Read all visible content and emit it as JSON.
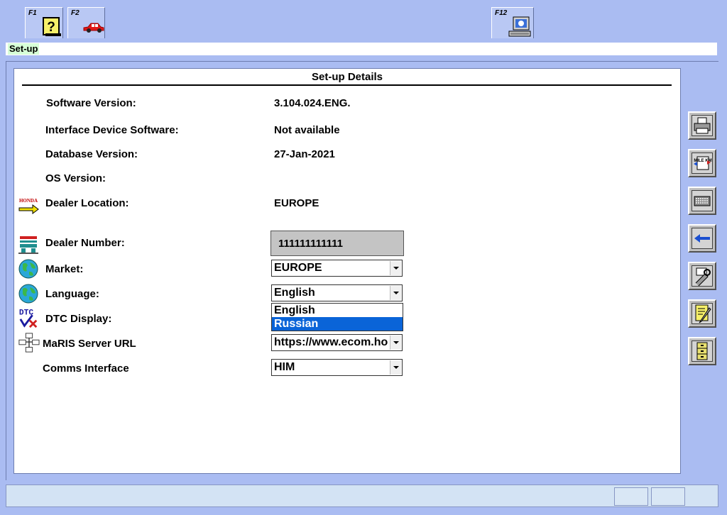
{
  "function_keys": [
    {
      "key": "F1",
      "icon": "help-icon"
    },
    {
      "key": "F2",
      "icon": "car-icon"
    },
    {
      "key": "F12",
      "icon": "computer-icon"
    }
  ],
  "breadcrumb": "Set-up",
  "panel_title": "Set-up Details",
  "fields": {
    "software_version": {
      "label": "Software Version:",
      "value": "3.104.024.ENG."
    },
    "interface_device": {
      "label": "Interface Device Software:",
      "value": "Not available"
    },
    "database_version": {
      "label": "Database Version:",
      "value": "27-Jan-2021"
    },
    "os_version": {
      "label": "OS Version:",
      "value": ""
    },
    "dealer_location": {
      "label": "Dealer Location:",
      "value": "EUROPE"
    },
    "dealer_number": {
      "label": "Dealer Number:",
      "value": "111111111111"
    },
    "market": {
      "label": "Market:",
      "value": "EUROPE"
    },
    "language": {
      "label": "Language:",
      "value": "English",
      "options": [
        "English",
        "Russian"
      ],
      "highlighted": "Russian"
    },
    "dtc_display": {
      "label": "DTC Display:"
    },
    "maris_url": {
      "label": "MaRIS Server URL",
      "value": "https://www.ecom.ho"
    },
    "comms_interface": {
      "label": "Comms Interface",
      "value": "HIM"
    }
  },
  "row_icons": {
    "dealer_location": "honda-flag-icon",
    "dealer_number": "dealer-number-icon",
    "market": "globe-icon",
    "language": "globe-icon",
    "dtc_display": "dtc-icon",
    "maris_url": "network-icon"
  },
  "honda_logo_text": "HONDA",
  "dtc_icon_text": "DTC",
  "side_buttons": [
    "print-icon",
    "mile-km-icon",
    "keyboard-icon",
    "back-arrow-icon",
    "tools-icon",
    "notes-icon",
    "cabinet-icon"
  ],
  "mile_km_text": "MILE KM",
  "colors": {
    "background": "#aabcf2",
    "highlight": "#0a64d8",
    "breadcrumb_bg": "#d7ffd7"
  }
}
